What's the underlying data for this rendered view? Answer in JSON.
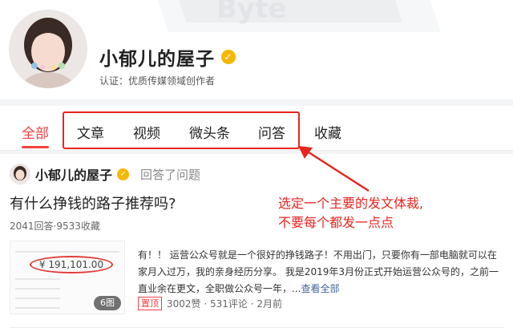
{
  "banner": {
    "watermark": "Byte"
  },
  "profile": {
    "name": "小郁儿的屋子",
    "certification": "认证：优质传媒领域创作者",
    "verified_icon": "verified-badge-icon"
  },
  "tabs": [
    {
      "label": "全部",
      "active": true
    },
    {
      "label": "文章",
      "active": false
    },
    {
      "label": "视频",
      "active": false
    },
    {
      "label": "微头条",
      "active": false
    },
    {
      "label": "问答",
      "active": false
    },
    {
      "label": "收藏",
      "active": false
    }
  ],
  "post": {
    "author": "小郁儿的屋子",
    "action": "回答了问题",
    "question": "有什么挣钱的路子推荐吗?",
    "stats": "2041回答·9533收藏",
    "thumbnail": {
      "amount": "¥ 191,101.00",
      "image_count": "6图"
    },
    "excerpt": "有！！ 运营公众号就是一个很好的挣钱路子！不用出门，只要你有一部电脑就可以在家月入过万，我的亲身经历分享。 我是2019年3月份正式开始运营公众号的，之前一直业余在更文，全职做公众号一年，...",
    "read_more": "查看全部",
    "pinned_label": "置顶",
    "meta": "3002赞 · 531评论 · 2月前"
  },
  "annotation": {
    "line1": "选定一个主要的发文体裁,",
    "line2": "不要每个都发一点点",
    "color": "#e8251f"
  },
  "colors": {
    "accent": "#f04142",
    "verified": "#f5b800",
    "link": "#406599"
  }
}
